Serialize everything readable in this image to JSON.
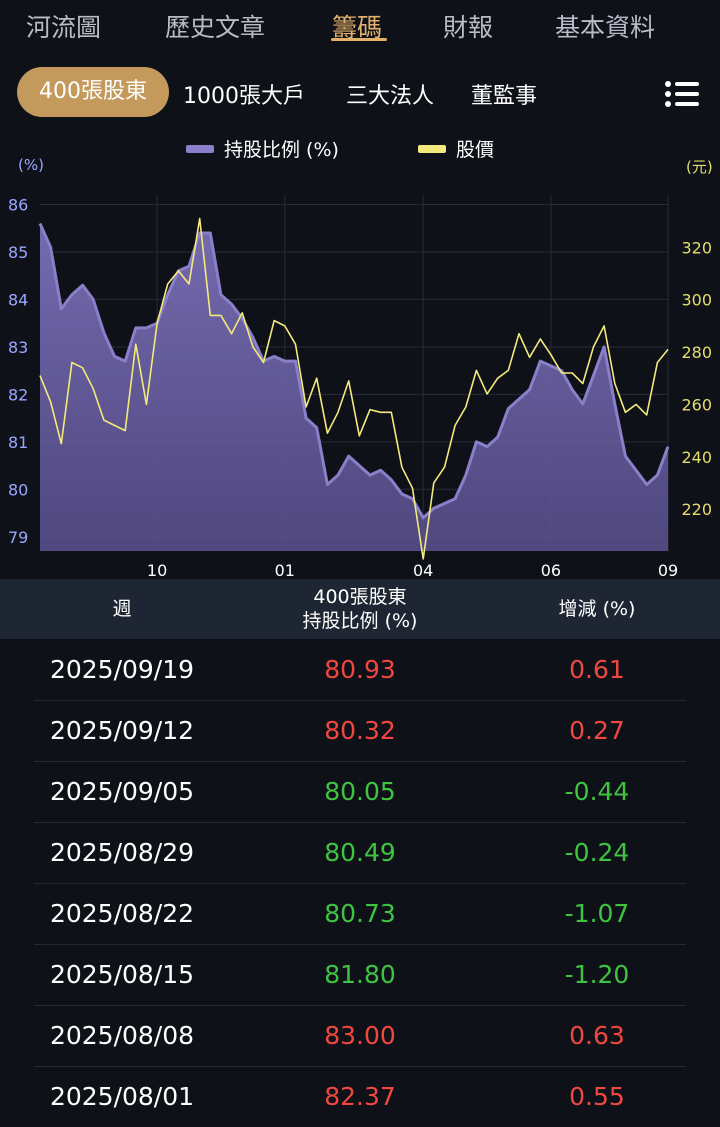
{
  "top_tabs": [
    "河流圖",
    "歷史文章",
    "籌碼",
    "財報",
    "基本資料"
  ],
  "sub_tabs": [
    "400張股東",
    "1000張大戶",
    "三大法人",
    "董監事"
  ],
  "legend": {
    "holding": "持股比例 (%)",
    "price": "股價"
  },
  "units": {
    "left": "(%)",
    "right": "(元)"
  },
  "colors": {
    "holding": "#8a7fc8",
    "price": "#f2ea7a",
    "accent": "#e3b06a",
    "up": "#f0483e",
    "down": "#3fc442"
  },
  "chart_data": {
    "type": "line",
    "x_ticks": [
      "10",
      "01",
      "04",
      "06",
      "09"
    ],
    "y_left_ticks": [
      "86",
      "85",
      "84",
      "83",
      "82",
      "81",
      "80",
      "79"
    ],
    "y_right_ticks": [
      "320",
      "300",
      "280",
      "260",
      "240",
      "220"
    ],
    "y_left_range": [
      78.7,
      86.2
    ],
    "y_right_range": [
      204,
      340
    ],
    "grid": true,
    "series": [
      {
        "name": "持股比例 (%)",
        "axis": "left",
        "values": [
          85.6,
          85.1,
          83.8,
          84.1,
          84.3,
          84.0,
          83.3,
          82.8,
          82.7,
          83.4,
          83.4,
          83.5,
          84.1,
          84.6,
          84.7,
          85.4,
          85.4,
          84.1,
          83.9,
          83.6,
          83.2,
          82.7,
          82.8,
          82.7,
          82.7,
          81.5,
          81.3,
          80.1,
          80.3,
          80.7,
          80.5,
          80.3,
          80.4,
          80.2,
          79.9,
          79.8,
          79.4,
          79.6,
          79.7,
          79.8,
          80.3,
          81.0,
          80.9,
          81.1,
          81.7,
          81.9,
          82.1,
          82.7,
          82.6,
          82.5,
          82.1,
          81.8,
          82.4,
          83.0,
          81.8,
          80.7,
          80.4,
          80.1,
          80.3,
          80.9
        ]
      },
      {
        "name": "股價",
        "axis": "right",
        "values": [
          271,
          261,
          245,
          276,
          274,
          266,
          254,
          252,
          250,
          283,
          260,
          291,
          306,
          311,
          306,
          331,
          294,
          294,
          287,
          295,
          282,
          276,
          292,
          290,
          283,
          259,
          270,
          249,
          257,
          269,
          248,
          258,
          257,
          257,
          236,
          228,
          201,
          230,
          236,
          252,
          259,
          273,
          264,
          270,
          273,
          287,
          278,
          285,
          279,
          272,
          272,
          268,
          282,
          290,
          268,
          257,
          260,
          256,
          276,
          281
        ]
      }
    ]
  },
  "table": {
    "headers": {
      "week": "週",
      "holding_line1": "400張股東",
      "holding_line2": "持股比例 (%)",
      "change": "增減 (%)"
    },
    "rows": [
      {
        "date": "2025/09/19",
        "value": "80.93",
        "change": "0.61",
        "trend": "up"
      },
      {
        "date": "2025/09/12",
        "value": "80.32",
        "change": "0.27",
        "trend": "up"
      },
      {
        "date": "2025/09/05",
        "value": "80.05",
        "change": "-0.44",
        "trend": "down"
      },
      {
        "date": "2025/08/29",
        "value": "80.49",
        "change": "-0.24",
        "trend": "down"
      },
      {
        "date": "2025/08/22",
        "value": "80.73",
        "change": "-1.07",
        "trend": "down"
      },
      {
        "date": "2025/08/15",
        "value": "81.80",
        "change": "-1.20",
        "trend": "down"
      },
      {
        "date": "2025/08/08",
        "value": "83.00",
        "change": "0.63",
        "trend": "up"
      },
      {
        "date": "2025/08/01",
        "value": "82.37",
        "change": "0.55",
        "trend": "up"
      }
    ]
  }
}
